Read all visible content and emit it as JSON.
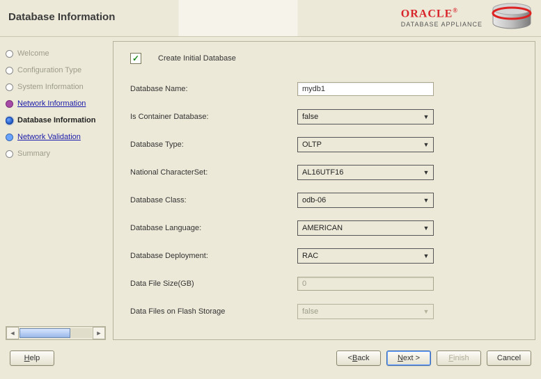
{
  "header": {
    "title": "Database Information",
    "brand_top": "ORACLE",
    "brand_sub": "DATABASE APPLIANCE"
  },
  "sidebar": {
    "steps": [
      {
        "label": "Welcome",
        "state": "future"
      },
      {
        "label": "Configuration Type",
        "state": "future"
      },
      {
        "label": "System Information",
        "state": "future"
      },
      {
        "label": "Network Information",
        "state": "visited"
      },
      {
        "label": "Database Information",
        "state": "current"
      },
      {
        "label": "Network Validation",
        "state": "next"
      },
      {
        "label": "Summary",
        "state": "future"
      }
    ]
  },
  "form": {
    "create_initial_db": {
      "label": "Create Initial Database",
      "checked": true
    },
    "fields": {
      "db_name": {
        "label": "Database Name:",
        "value": "mydb1",
        "type": "text"
      },
      "is_container": {
        "label": "Is Container Database:",
        "value": "false",
        "type": "select"
      },
      "db_type": {
        "label": "Database Type:",
        "value": "OLTP",
        "type": "select"
      },
      "charset": {
        "label": "National CharacterSet:",
        "value": "AL16UTF16",
        "type": "select"
      },
      "db_class": {
        "label": "Database Class:",
        "value": "odb-06",
        "type": "select"
      },
      "db_lang": {
        "label": "Database Language:",
        "value": "AMERICAN",
        "type": "select"
      },
      "db_deploy": {
        "label": "Database Deployment:",
        "value": "RAC",
        "type": "select"
      },
      "file_size": {
        "label": "Data File Size(GB)",
        "value": "0",
        "type": "text",
        "disabled": true
      },
      "flash_storage": {
        "label": "Data Files on Flash Storage",
        "value": "false",
        "type": "select",
        "disabled": true
      }
    }
  },
  "footer": {
    "help": "Help",
    "back": "< Back",
    "next": "Next >",
    "finish": "Finish",
    "cancel": "Cancel"
  }
}
